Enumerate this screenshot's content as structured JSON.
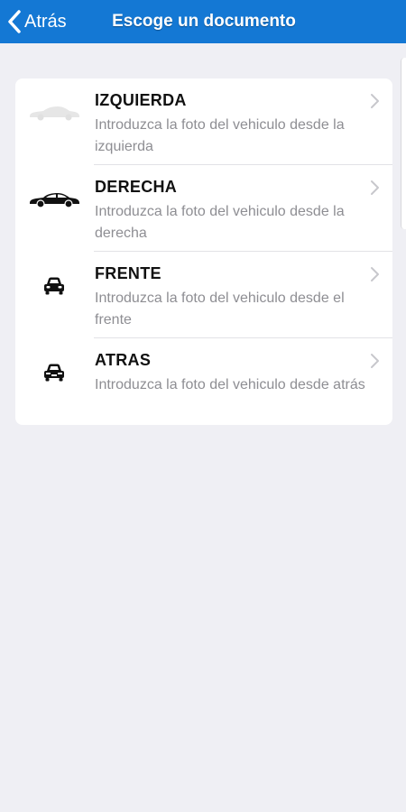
{
  "navbar": {
    "back_label": "Atrás",
    "title": "Escoge un documento",
    "background_color": "#1478d4"
  },
  "list": {
    "items": [
      {
        "title": "IZQUIERDA",
        "subtitle": "Introduzca la foto del vehiculo desde la izquierda",
        "icon": "car-side-faded-icon"
      },
      {
        "title": "DERECHA",
        "subtitle": "Introduzca la foto del vehiculo desde la derecha",
        "icon": "car-side-icon"
      },
      {
        "title": "FRENTE",
        "subtitle": "Introduzca la foto del vehiculo desde el frente",
        "icon": "car-front-icon"
      },
      {
        "title": "ATRAS",
        "subtitle": "Introduzca la foto del vehiculo desde atrás",
        "icon": "car-rear-icon"
      }
    ]
  }
}
